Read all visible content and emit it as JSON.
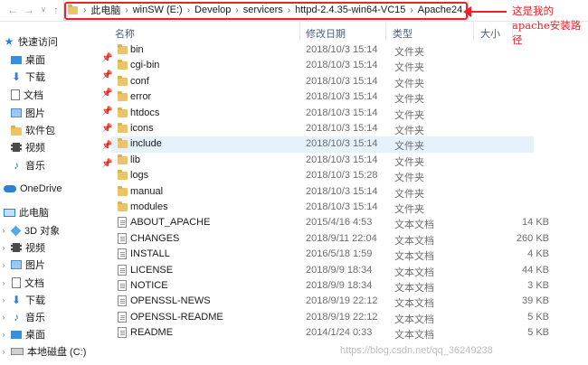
{
  "address_bar": {
    "crumbs": [
      "此电脑",
      "winSW (E:)",
      "Develop",
      "servicers",
      "httpd-2.4.35-win64-VC15",
      "Apache24"
    ]
  },
  "annotation": {
    "text": "这是我的apache安装路径",
    "color": "#e8232b"
  },
  "nav": {
    "quick_access": "快速访问",
    "items": [
      {
        "label": "桌面",
        "icon": "desktop-icon"
      },
      {
        "label": "下载",
        "icon": "download-icon"
      },
      {
        "label": "文档",
        "icon": "document-icon"
      },
      {
        "label": "图片",
        "icon": "picture-icon"
      },
      {
        "label": "软件包",
        "icon": "folder-icon"
      },
      {
        "label": "视频",
        "icon": "video-icon"
      },
      {
        "label": "音乐",
        "icon": "music-icon"
      }
    ],
    "onedrive": "OneDrive",
    "this_pc": "此电脑",
    "pc_items": [
      {
        "label": "3D 对象",
        "icon": "3d-objects-icon"
      },
      {
        "label": "视频",
        "icon": "video-icon"
      },
      {
        "label": "图片",
        "icon": "picture-icon"
      },
      {
        "label": "文档",
        "icon": "document-icon"
      },
      {
        "label": "下载",
        "icon": "download-icon"
      },
      {
        "label": "音乐",
        "icon": "music-icon"
      },
      {
        "label": "桌面",
        "icon": "desktop-icon"
      },
      {
        "label": "本地磁盘 (C:)",
        "icon": "drive-icon"
      }
    ]
  },
  "columns": {
    "name": "名称",
    "date": "修改日期",
    "type": "类型",
    "size": "大小"
  },
  "files": [
    {
      "name": "bin",
      "date": "2018/10/3 15:14",
      "type": "文件夹",
      "size": "",
      "kind": "folder"
    },
    {
      "name": "cgi-bin",
      "date": "2018/10/3 15:14",
      "type": "文件夹",
      "size": "",
      "kind": "folder"
    },
    {
      "name": "conf",
      "date": "2018/10/3 15:14",
      "type": "文件夹",
      "size": "",
      "kind": "folder"
    },
    {
      "name": "error",
      "date": "2018/10/3 15:14",
      "type": "文件夹",
      "size": "",
      "kind": "folder"
    },
    {
      "name": "htdocs",
      "date": "2018/10/3 15:14",
      "type": "文件夹",
      "size": "",
      "kind": "folder"
    },
    {
      "name": "icons",
      "date": "2018/10/3 15:14",
      "type": "文件夹",
      "size": "",
      "kind": "folder"
    },
    {
      "name": "include",
      "date": "2018/10/3 15:14",
      "type": "文件夹",
      "size": "",
      "kind": "folder",
      "selected": true
    },
    {
      "name": "lib",
      "date": "2018/10/3 15:14",
      "type": "文件夹",
      "size": "",
      "kind": "folder"
    },
    {
      "name": "logs",
      "date": "2018/10/3 15:28",
      "type": "文件夹",
      "size": "",
      "kind": "folder"
    },
    {
      "name": "manual",
      "date": "2018/10/3 15:14",
      "type": "文件夹",
      "size": "",
      "kind": "folder"
    },
    {
      "name": "modules",
      "date": "2018/10/3 15:14",
      "type": "文件夹",
      "size": "",
      "kind": "folder"
    },
    {
      "name": "ABOUT_APACHE",
      "date": "2015/4/16 4:53",
      "type": "文本文档",
      "size": "14 KB",
      "kind": "file"
    },
    {
      "name": "CHANGES",
      "date": "2018/9/11 22:04",
      "type": "文本文档",
      "size": "260 KB",
      "kind": "file"
    },
    {
      "name": "INSTALL",
      "date": "2016/5/18 1:59",
      "type": "文本文档",
      "size": "4 KB",
      "kind": "file"
    },
    {
      "name": "LICENSE",
      "date": "2018/9/9 18:34",
      "type": "文本文档",
      "size": "44 KB",
      "kind": "file"
    },
    {
      "name": "NOTICE",
      "date": "2018/9/9 18:34",
      "type": "文本文档",
      "size": "3 KB",
      "kind": "file"
    },
    {
      "name": "OPENSSL-NEWS",
      "date": "2018/9/19 22:12",
      "type": "文本文档",
      "size": "39 KB",
      "kind": "file"
    },
    {
      "name": "OPENSSL-README",
      "date": "2018/9/19 22:12",
      "type": "文本文档",
      "size": "5 KB",
      "kind": "file"
    },
    {
      "name": "README",
      "date": "2014/1/24 0:33",
      "type": "文本文档",
      "size": "5 KB",
      "kind": "file"
    }
  ],
  "watermark": "https://blog.csdn.net/qq_36249238"
}
